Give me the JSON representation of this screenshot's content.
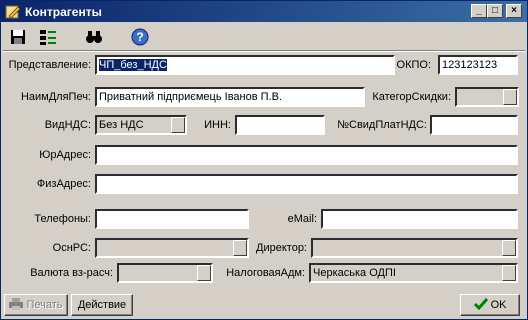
{
  "window": {
    "title": "Контрагенты"
  },
  "toolbar": {
    "icons": [
      "save-icon",
      "tree-icon",
      "binoculars-icon",
      "help-icon"
    ]
  },
  "form": {
    "representation": {
      "label": "Представление:",
      "value": "ЧП_без_НДС"
    },
    "okpo": {
      "label": "ОКПО:",
      "value": "123123123"
    },
    "print_name": {
      "label": "НаимДляПеч:",
      "value": "Приватний підприємець Іванов П.В."
    },
    "discount_category": {
      "label": "КатегорСкидки:",
      "value": ""
    },
    "vat_type": {
      "label": "ВидНДС:",
      "value": "Без НДС"
    },
    "inn": {
      "label": "ИНН:",
      "value": ""
    },
    "vat_cert": {
      "label": "№СвидПлатНДС:",
      "value": ""
    },
    "legal_address": {
      "label": "ЮрАдрес:",
      "value": ""
    },
    "physical_address": {
      "label": "ФизАдрес:",
      "value": ""
    },
    "phones": {
      "label": "Телефоны:",
      "value": ""
    },
    "email": {
      "label": "eMail:",
      "value": ""
    },
    "main_account": {
      "label": "ОснРС:",
      "value": ""
    },
    "director": {
      "label": "Директор:",
      "value": ""
    },
    "settlement_currency": {
      "label": "Валюта вз-расч:",
      "value": ""
    },
    "tax_admin": {
      "label": "НалоговаяАдм:",
      "value": "Черкаська ОДПІ"
    }
  },
  "footer": {
    "print_label": "Печать",
    "action_label": "Действие",
    "ok_label": "OK"
  }
}
